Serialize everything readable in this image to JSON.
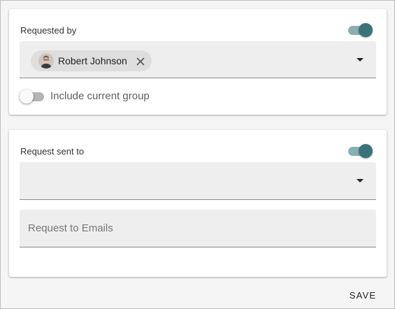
{
  "requested_by": {
    "label": "Requested by",
    "toggle_on": true,
    "chip": {
      "name": "Robert Johnson",
      "avatar_icon": "person-avatar-icon",
      "remove_icon": "close-icon"
    },
    "dropdown_icon": "chevron-down-icon",
    "include_current_group": {
      "label": "Include current group",
      "on": false
    }
  },
  "request_sent_to": {
    "label": "Request sent to",
    "toggle_on": true,
    "dropdown_icon": "chevron-down-icon",
    "emails_placeholder": "Request to Emails"
  },
  "actions": {
    "save_label": "SAVE"
  },
  "colors": {
    "toggle_thumb_on": "#3a7379",
    "toggle_track_on": "#8ab0b0",
    "field_bg": "#eeeeee",
    "chip_bg": "#dedede"
  }
}
